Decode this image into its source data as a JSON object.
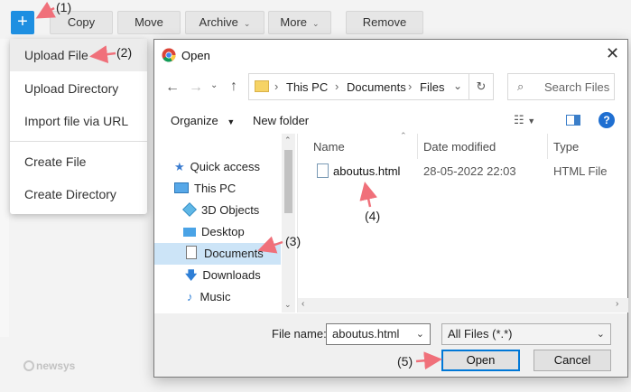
{
  "toolbar": {
    "add_label": "+",
    "copy": "Copy",
    "move": "Move",
    "archive": "Archive",
    "more": "More",
    "remove": "Remove"
  },
  "menu": {
    "items": [
      "Upload File",
      "Upload Directory",
      "Import file via URL",
      "Create File",
      "Create Directory"
    ]
  },
  "annotations": [
    "(1)",
    "(2)",
    "(3)",
    "(4)",
    "(5)"
  ],
  "watermark": "newsys",
  "dialog": {
    "title": "Open",
    "breadcrumb": [
      "This PC",
      "Documents",
      "Files"
    ],
    "search_placeholder": "Search Files",
    "organize": "Organize",
    "new_folder": "New folder",
    "tree": [
      {
        "label": "Quick access",
        "icon": "star-icon"
      },
      {
        "label": "This PC",
        "icon": "computer-icon"
      },
      {
        "label": "3D Objects",
        "icon": "cube-icon"
      },
      {
        "label": "Desktop",
        "icon": "desktop-icon"
      },
      {
        "label": "Documents",
        "icon": "document-icon",
        "selected": true
      },
      {
        "label": "Downloads",
        "icon": "download-icon"
      },
      {
        "label": "Music",
        "icon": "music-icon"
      }
    ],
    "columns": [
      "Name",
      "Date modified",
      "Type"
    ],
    "files": [
      {
        "name": "aboutus.html",
        "date": "28-05-2022 22:03",
        "type": "HTML File"
      }
    ],
    "file_name_label": "File name:",
    "file_name_value": "aboutus.html",
    "filter": "All Files (*.*)",
    "open": "Open",
    "cancel": "Cancel"
  },
  "colors": {
    "accent": "#1e8fe1",
    "arrow": "#f0707a",
    "selection": "#cce4f7",
    "primary_border": "#0078d7"
  }
}
